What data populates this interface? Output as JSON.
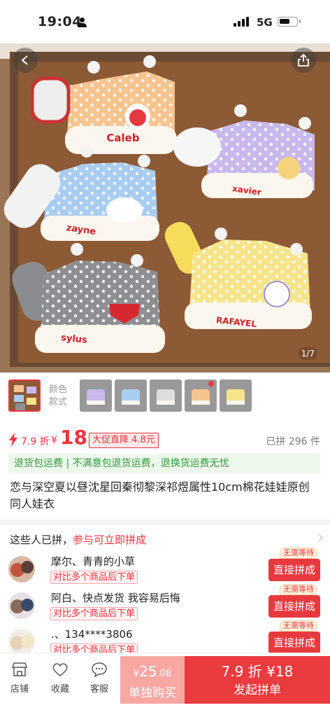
{
  "status_bar": {
    "time": "19:04",
    "network": "5G"
  },
  "hero": {
    "page_indicator": "1/7",
    "hats": [
      {
        "name": "Caleb",
        "color": "#f6c48f"
      },
      {
        "name": "xavier",
        "color": "#c8b8ec"
      },
      {
        "name": "zayne",
        "color": "#a9cdf0"
      },
      {
        "name": "RAFAYEL",
        "color": "#f6e48b"
      },
      {
        "name": "sylus",
        "color": "#8f8f93"
      }
    ]
  },
  "variants": {
    "caption": "颜色\n款式"
  },
  "price": {
    "discount": "7.9 折",
    "currency": "¥",
    "amount": "18",
    "promo": "大促直降 4.8元",
    "joined": "已拼 296 件"
  },
  "notice": {
    "part1": "退货包运费",
    "part2": " | 不满意包退货运费，退换货运费无忧"
  },
  "product": {
    "title": "恋与深空夏以昼沈星回秦彻黎深祁煜属性10cm棉花娃娃原创同人娃衣"
  },
  "group": {
    "heading_prefix": "这些人已拼，",
    "heading_action": "参与可立即拼成",
    "rows": [
      {
        "name": "摩尔、青青的小草",
        "sub": "对比多个商品后下单",
        "tag": "无需等待",
        "button": "直接拼成"
      },
      {
        "name": "阿白、快点发货 我容易后悔",
        "sub": "对比多个商品后下单",
        "tag": "无需等待",
        "button": "直接拼成"
      },
      {
        "name": ".、134****3806",
        "sub": "对比多个商品后下单",
        "tag": "无需等待",
        "button": "直接拼成"
      }
    ]
  },
  "bottom": {
    "store": "店铺",
    "favorite": "收藏",
    "service": "客服",
    "single_price_currency": "¥",
    "single_price_int": "25",
    "single_price_dec": ".08",
    "single_label": "单独购买",
    "group_price": "7.9 折 ¥18",
    "group_label": "发起拼单"
  },
  "colors": {
    "accent": "#ef3340",
    "green": "#2f9b3a"
  }
}
